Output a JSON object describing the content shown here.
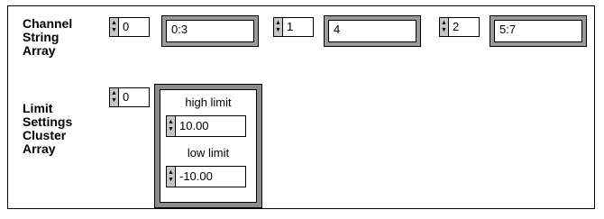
{
  "channel_string_array": {
    "label": "Channel\nString\nArray",
    "elements": [
      {
        "index": "0",
        "value": "0:3"
      },
      {
        "index": "1",
        "value": "4"
      },
      {
        "index": "2",
        "value": "5:7"
      }
    ]
  },
  "limit_settings": {
    "label": "Limit\nSettings\nCluster\nArray",
    "index": "0",
    "high_label": "high limit",
    "high_value": "10.00",
    "low_label": "low limit",
    "low_value": "-10.00"
  },
  "icons": {
    "up": "▲",
    "down": "▼"
  }
}
